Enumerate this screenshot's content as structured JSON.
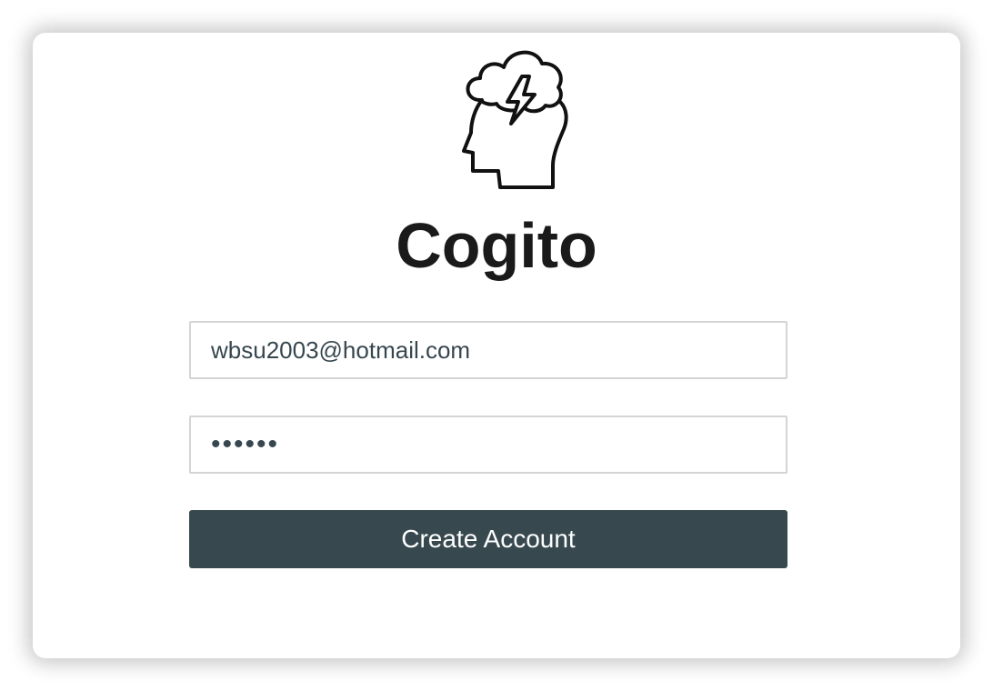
{
  "app": {
    "title": "Cogito",
    "logo_icon": "head-with-storm-cloud-icon"
  },
  "form": {
    "email_value": "wbsu2003@hotmail.com",
    "password_value": "••••••",
    "submit_label": "Create Account"
  },
  "colors": {
    "button_bg": "#37494f",
    "button_text": "#ffffff",
    "input_border": "#d4d4d4",
    "input_text": "#37474f",
    "title_text": "#1a1a1a"
  }
}
